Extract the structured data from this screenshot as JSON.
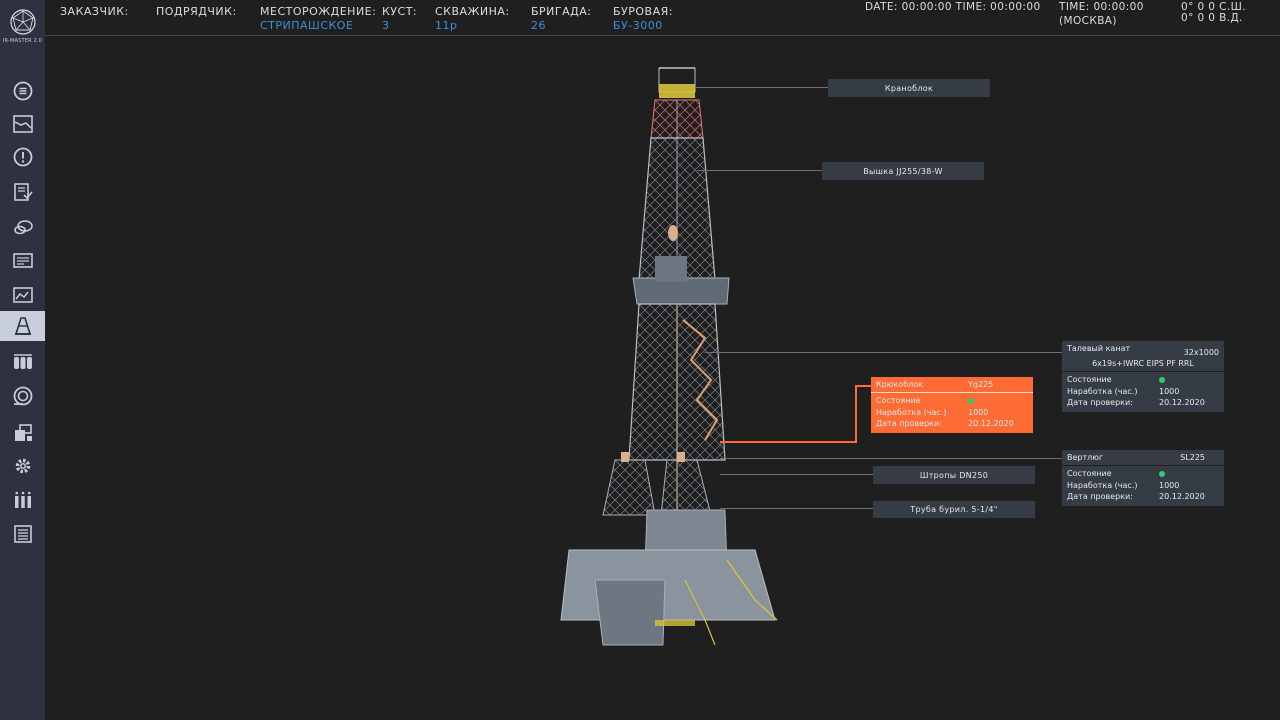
{
  "app": {
    "logo_text": "IR-MASTER 2.0"
  },
  "nav": {
    "items": [
      {
        "icon": "list-icon"
      },
      {
        "icon": "chart-icon"
      },
      {
        "icon": "alert-icon"
      },
      {
        "icon": "report-icon"
      },
      {
        "icon": "chat-icon"
      },
      {
        "icon": "monitor-icon"
      },
      {
        "icon": "graph-icon"
      },
      {
        "icon": "rig-icon",
        "active": true
      },
      {
        "icon": "cylinders-icon"
      },
      {
        "icon": "turbine-icon"
      },
      {
        "icon": "blocks-icon"
      },
      {
        "icon": "gear-icon"
      },
      {
        "icon": "columns-icon"
      },
      {
        "icon": "document-icon"
      }
    ]
  },
  "header": {
    "customer_label": "ЗАКАЗЧИК:",
    "contractor_label": "ПОДРЯДЧИК:",
    "field_label": "МЕСТОРОЖДЕНИЕ:",
    "field_value": "СТРИПАШСКОЕ",
    "pad_label": "КУСТ:",
    "pad_value": "3",
    "well_label": "СКВАЖИНА:",
    "well_value": "11р",
    "crew_label": "БРИГАДА:",
    "crew_value": "26",
    "rig_label": "БУРОВАЯ:",
    "rig_value": "БУ-3000",
    "datetime": "DATE: 00:00:00  TIME: 00:00:00",
    "moscow_time": "TIME: 00:00:00",
    "moscow_label": "(МОСКВА)",
    "lat": "0°  0 0   С.Ш.",
    "lon": "0°  0 0   В.Д."
  },
  "labels": {
    "crown_block": "Кранoблок",
    "derrick": "Вышка JJ255/38-W",
    "links": "Штропы DN250",
    "drill_pipe": "Труба бурил. 5-1/4\""
  },
  "cards": {
    "rope": {
      "title": "Талевый канат",
      "value": "32x1000",
      "subtitle": "6x19s+IWRC EIPS PF RRL",
      "state_label": "Состояние",
      "hours_label": "Наработка (час.)",
      "hours_value": "1000",
      "date_label": "Дата проверки:",
      "date_value": "20.12.2020"
    },
    "hook": {
      "title": "Крюкоблок",
      "value": "Yg225",
      "state_label": "Состояние",
      "hours_label": "Наработка (час.)",
      "hours_value": "1000",
      "date_label": "Дата проверки:",
      "date_value": "20.12.2020"
    },
    "swivel": {
      "title": "Вертлюг",
      "value": "SL225",
      "state_label": "Состояние",
      "hours_label": "Наработка (час.)",
      "hours_value": "1000",
      "date_label": "Дата проверки:",
      "date_value": "20.12.2020"
    }
  },
  "colors": {
    "accent": "#3f8fd9",
    "highlight": "#ff6b35",
    "status_ok": "#2ecc71",
    "sidebar": "#2d3140",
    "background": "#1f1f1f"
  }
}
